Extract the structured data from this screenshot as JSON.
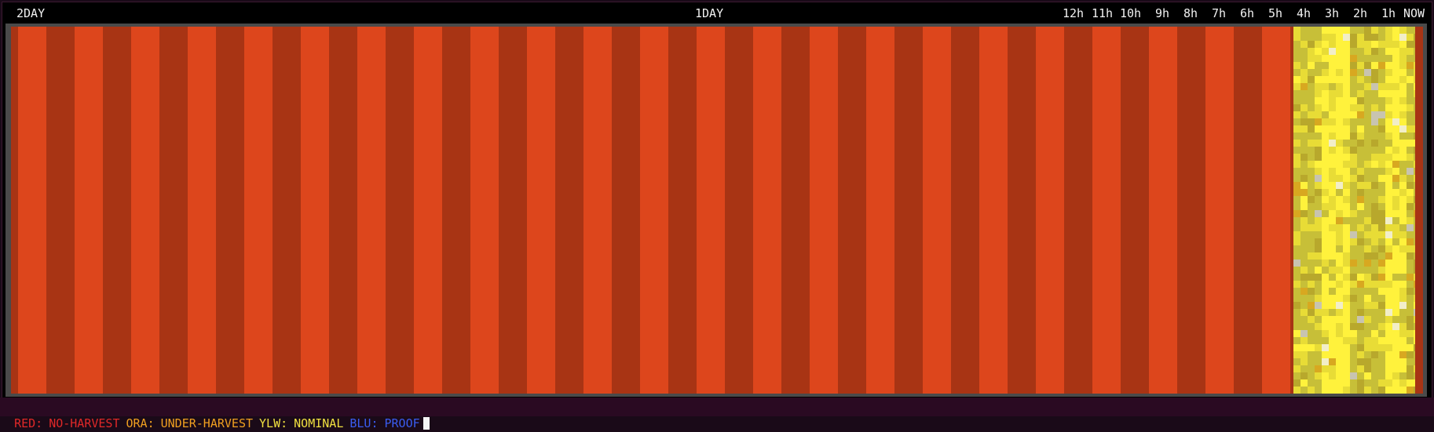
{
  "timeline": {
    "labels": [
      "2DAY",
      "1DAY",
      "12h",
      "11h",
      "10h",
      "9h",
      "8h",
      "7h",
      "6h",
      "5h",
      "4h",
      "3h",
      "2h",
      "1h",
      "NOW"
    ]
  },
  "legend": {
    "items": [
      {
        "key": "RED:",
        "value": "NO-HARVEST",
        "key_color": "#e02828",
        "value_color": "#e02828"
      },
      {
        "key": "ORA:",
        "value": "UNDER-HARVEST",
        "key_color": "#f0a020",
        "value_color": "#f0a020"
      },
      {
        "key": "YLW:",
        "value": "NOMINAL",
        "key_color": "#f0e040",
        "value_color": "#f0e040"
      },
      {
        "key": "BLU:",
        "value": "PROOF",
        "key_color": "#3a5cf0",
        "value_color": "#3a5cf0"
      }
    ]
  },
  "colors": {
    "red_light": "#dd461c",
    "red_dark": "#a83414",
    "yellow_bright": "#fff23c",
    "yellow_mid": "#e8dc36",
    "olive": "#c7bf38",
    "olive_dark": "#b8a82c",
    "gold": "#d8a820",
    "pale": "#f2eec8",
    "gray": "#c8c4b0"
  }
}
